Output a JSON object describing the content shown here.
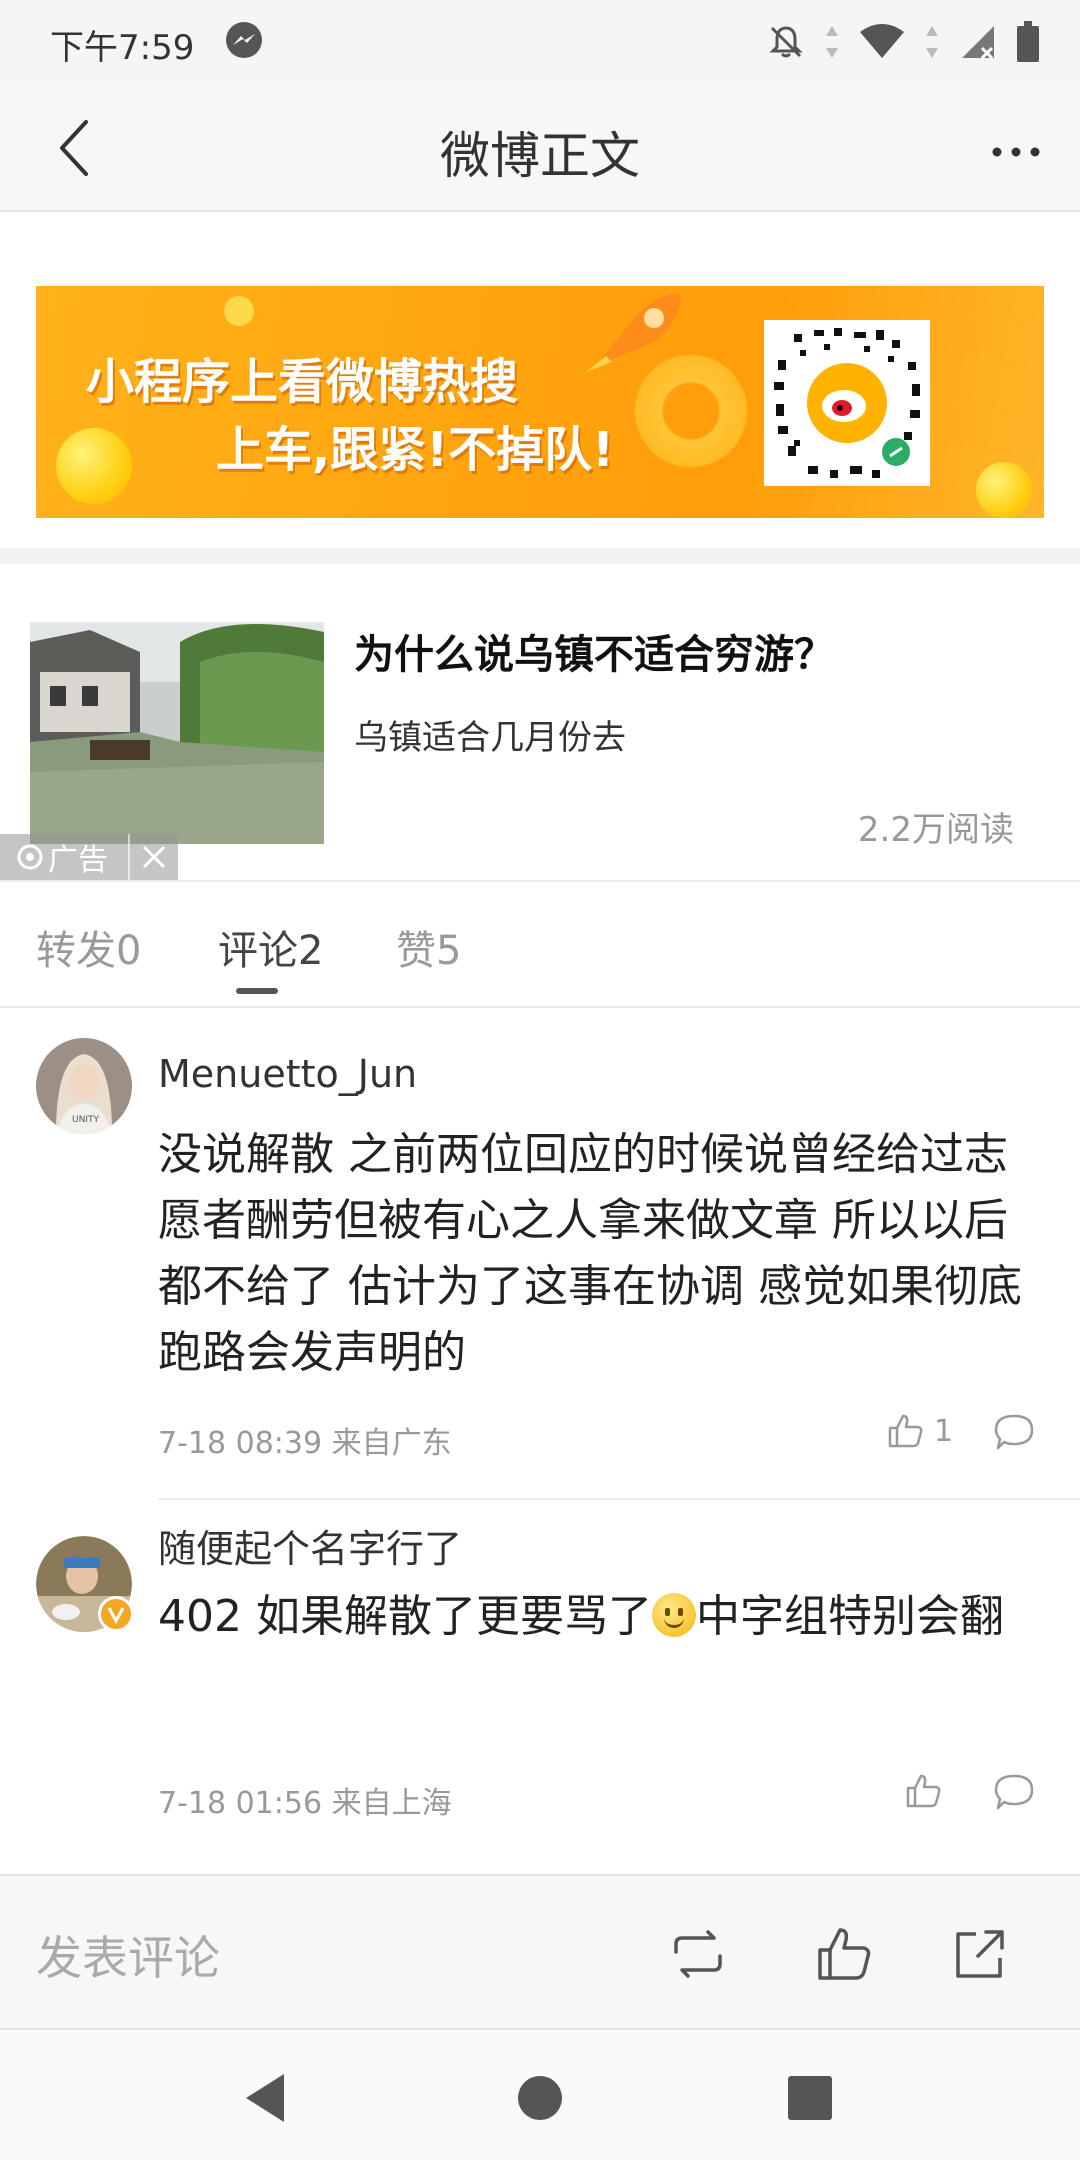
{
  "status_bar": {
    "time": "下午7:59"
  },
  "header": {
    "title": "微博正文"
  },
  "banner": {
    "line1": "小程序上看微博热搜",
    "line2": "上车,跟紧!不掉队!"
  },
  "ad_card": {
    "title": "为什么说乌镇不适合穷游？",
    "subtitle": "乌镇适合几月份去",
    "reads": "2.2万阅读",
    "ad_label": "广告"
  },
  "tabs": [
    {
      "label": "转发0",
      "active": false
    },
    {
      "label": "评论2",
      "active": true
    },
    {
      "label": "赞5",
      "active": false
    }
  ],
  "comments": [
    {
      "username": "Menuetto_Jun",
      "text": "没说解散 之前两位回应的时候说曾经给过志愿者酬劳但被有心之人拿来做文章 所以以后都不给了 估计为了这事在协调 感觉如果彻底跑路会发声明的",
      "meta": "7-18 08:39 来自广东",
      "likes": "1"
    },
    {
      "username": "随便起个名字行了",
      "text_before": "402 如果解散了更要骂了",
      "text_after": "中字组特别会翻",
      "meta": "7-18 01:56 来自上海",
      "likes": ""
    }
  ],
  "action_bar": {
    "comment_placeholder": "发表评论"
  },
  "colors": {
    "banner_orange": "#ffa40f",
    "text_gray": "#999999",
    "verified_badge": "#f5a623"
  }
}
